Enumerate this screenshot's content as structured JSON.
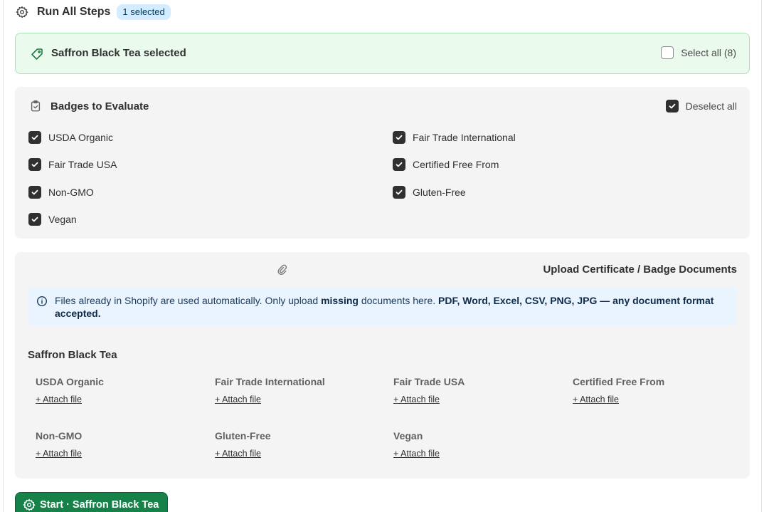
{
  "header": {
    "title": "Run All Steps",
    "selected_badge": "1 selected",
    "icon": "gear-icon"
  },
  "selection": {
    "label": "Saffron Black Tea selected",
    "select_all_label": "Select all (8)",
    "icon": "tag-icon",
    "colors": {
      "background": "#eafbee",
      "border": "#a7e3b5"
    }
  },
  "badges_panel": {
    "title": "Badges to Evaluate",
    "deselect_all_label": "Deselect all",
    "icon": "clipboard-check-icon",
    "items": [
      {
        "label": "USDA Organic",
        "checked": true
      },
      {
        "label": "Fair Trade International",
        "checked": true
      },
      {
        "label": "Fair Trade USA",
        "checked": true
      },
      {
        "label": "Certified Free From",
        "checked": true
      },
      {
        "label": "Non-GMO",
        "checked": true
      },
      {
        "label": "Gluten-Free",
        "checked": true
      },
      {
        "label": "Vegan",
        "checked": true
      }
    ]
  },
  "upload_panel": {
    "title": "Upload Certificate / Badge Documents",
    "icon": "paperclip-icon",
    "info": {
      "icon": "info-icon",
      "text_1": "Files already in Shopify are used automatically. Only upload ",
      "bold_1": "missing",
      "text_2": " documents here. ",
      "bold_2": "PDF, Word, Excel, CSV, PNG, JPG — any document format accepted."
    },
    "product_name": "Saffron Black Tea",
    "attach_label": "+ Attach file",
    "documents": [
      {
        "label": "USDA Organic"
      },
      {
        "label": "Fair Trade International"
      },
      {
        "label": "Fair Trade USA"
      },
      {
        "label": "Certified Free From"
      },
      {
        "label": "Non-GMO"
      },
      {
        "label": "Gluten-Free"
      },
      {
        "label": "Vegan"
      }
    ]
  },
  "start_button": {
    "label": "Start · Saffron Black Tea",
    "icon": "gear-icon",
    "color": "#16824a"
  }
}
